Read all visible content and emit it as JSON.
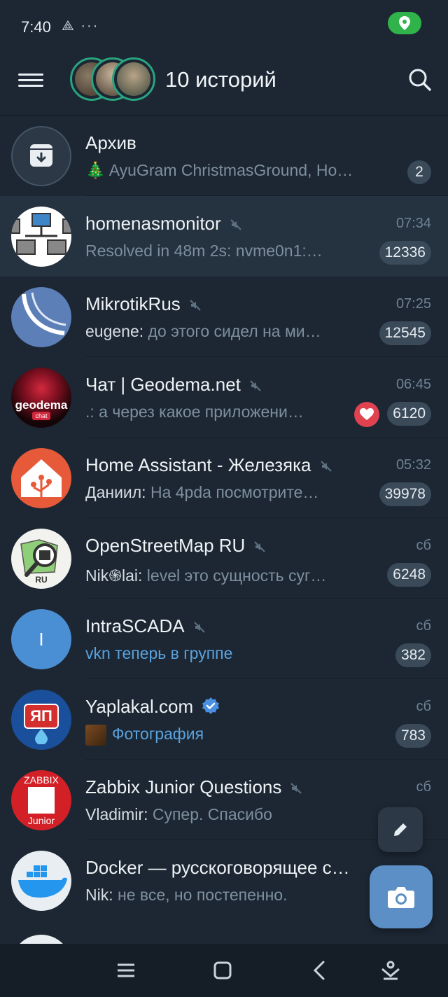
{
  "status_bar": {
    "time": "7:40",
    "icons": "⟁ ···",
    "location_icon": "location-pin-icon"
  },
  "header": {
    "title": "10 историй",
    "menu_icon": "hamburger-menu-icon",
    "search_icon": "search-icon"
  },
  "chats": [
    {
      "title": "Архив",
      "sender": "",
      "preview": "🎄 AyuGram ChristmasGround, Но…",
      "time": "",
      "badge": "2",
      "muted": false
    },
    {
      "title": "homenasmonitor",
      "sender": "",
      "preview": "Resolved in 48m 2s: nvme0n1:…",
      "time": "07:34",
      "badge": "12336",
      "muted": true
    },
    {
      "title": "MikrotikRus",
      "sender": "eugene:",
      "preview": " до этого сидел на ми…",
      "time": "07:25",
      "badge": "12545",
      "muted": true
    },
    {
      "title": "Чат | Geodema.net",
      "sender": "",
      "preview": ".: а через какое приложени…",
      "time": "06:45",
      "badge": "6120",
      "muted": true,
      "reaction": "heart"
    },
    {
      "title": "Home Assistant - Железяка",
      "sender": "Даниил:",
      "preview": " На 4pda посмотрите…",
      "time": "05:32",
      "badge": "39978",
      "muted": true
    },
    {
      "title": "OpenStreetMap RU",
      "sender": "Nik֍lai:",
      "preview": " level это сущность суг…",
      "time": "сб",
      "badge": "6248",
      "muted": true
    },
    {
      "title": "IntraSCADA",
      "sender": "",
      "preview": "vkn теперь в группе",
      "time": "сб",
      "badge": "382",
      "muted": true,
      "accent": true
    },
    {
      "title": "Yaplakal.com",
      "sender": "",
      "preview": "Фотография",
      "time": "сб",
      "badge": "783",
      "muted": false,
      "verified": true,
      "accent": true
    },
    {
      "title": "Zabbix Junior Questions",
      "sender": "Vladimir:",
      "preview": " Супер. Спасибо",
      "time": "сб",
      "badge": "",
      "muted": true
    },
    {
      "title": "Docker — русскоговорящее с…",
      "sender": "Nik:",
      "preview": " не все, но постепенно.",
      "time": "",
      "badge": "",
      "muted": false
    }
  ],
  "avatars": {
    "archive": "archive-box-icon",
    "mikrotik_text": "",
    "geodema_text": "geodema",
    "geodema_sub": "chat",
    "osm_text": "RU",
    "intrascada_letter": "I",
    "yaplakal_text": "ЯП",
    "zabbix_top": "ZABBIX",
    "zabbix_bottom": "Junior"
  },
  "colors": {
    "background": "#1c2733",
    "accent": "#5aa2dd",
    "badge": "#3b4a58",
    "fab": "#5b8fc5",
    "location": "#2fb34a"
  }
}
